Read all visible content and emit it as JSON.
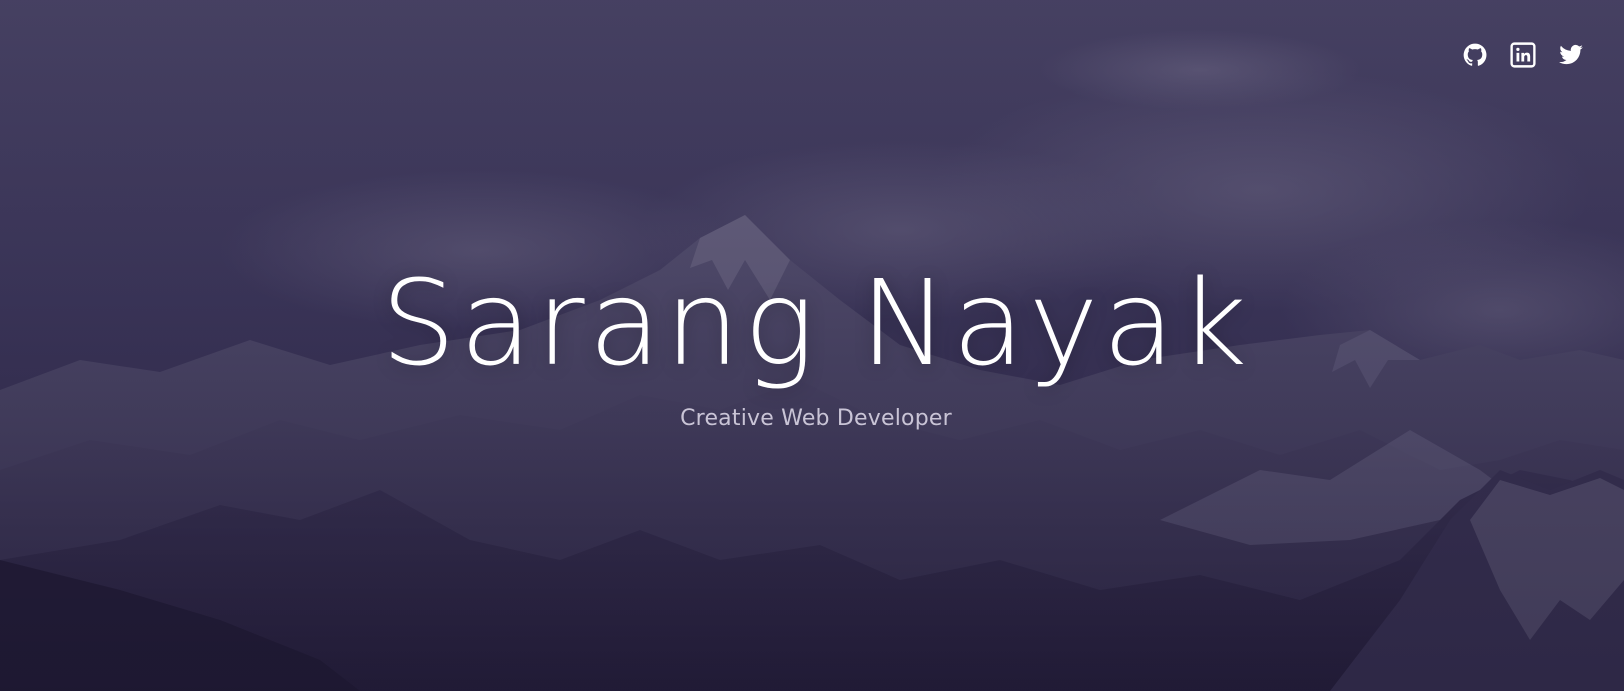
{
  "hero": {
    "title": "Sarang Nayak",
    "subtitle": "Creative Web Developer",
    "overlay_color": "#2d2548",
    "text_color": "#ffffff",
    "subtitle_color": "#c9c4d6"
  },
  "social_links": [
    {
      "icon": "github-icon",
      "label": "GitHub"
    },
    {
      "icon": "linkedin-icon",
      "label": "LinkedIn"
    },
    {
      "icon": "twitter-icon",
      "label": "Twitter"
    }
  ]
}
